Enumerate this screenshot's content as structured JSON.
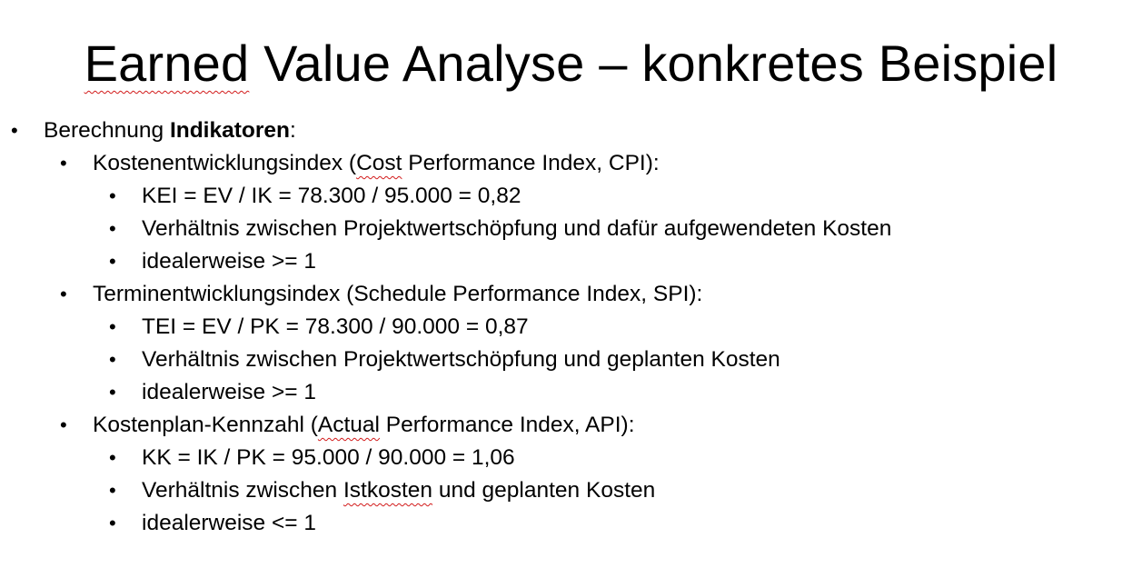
{
  "slide": {
    "title_part1": "Earned",
    "title_part2": " Value Analyse – konkretes Beispiel"
  },
  "bullets": {
    "bullet_char": "•",
    "intro": {
      "prefix": "Berechnung ",
      "bold": "Indikatoren",
      "suffix": ":"
    },
    "cpi": {
      "heading_part1": "Kostenentwicklungsindex (",
      "heading_spell": "Cost",
      "heading_part2": " Performance Index, CPI):",
      "formula": "KEI = EV / IK = 78.300 / 95.000 = 0,82",
      "meaning": "Verhältnis zwischen Projektwertschöpfung und dafür aufgewendeten Kosten",
      "ideal": "idealerweise >= 1"
    },
    "spi": {
      "heading": "Terminentwicklungsindex (Schedule Performance Index, SPI):",
      "formula": "TEI = EV / PK = 78.300 / 90.000 = 0,87",
      "meaning": "Verhältnis zwischen Projektwertschöpfung und geplanten Kosten",
      "ideal": "idealerweise >= 1"
    },
    "api": {
      "heading_part1": "Kostenplan-Kennzahl (",
      "heading_spell": "Actual",
      "heading_part2": " Performance Index, API):",
      "formula": "KK = IK / PK = 95.000 / 90.000 = 1,06",
      "meaning_part1": "Verhältnis zwischen ",
      "meaning_spell": "Istkosten",
      "meaning_part2": " und geplanten Kosten",
      "ideal": "idealerweise <= 1"
    }
  }
}
